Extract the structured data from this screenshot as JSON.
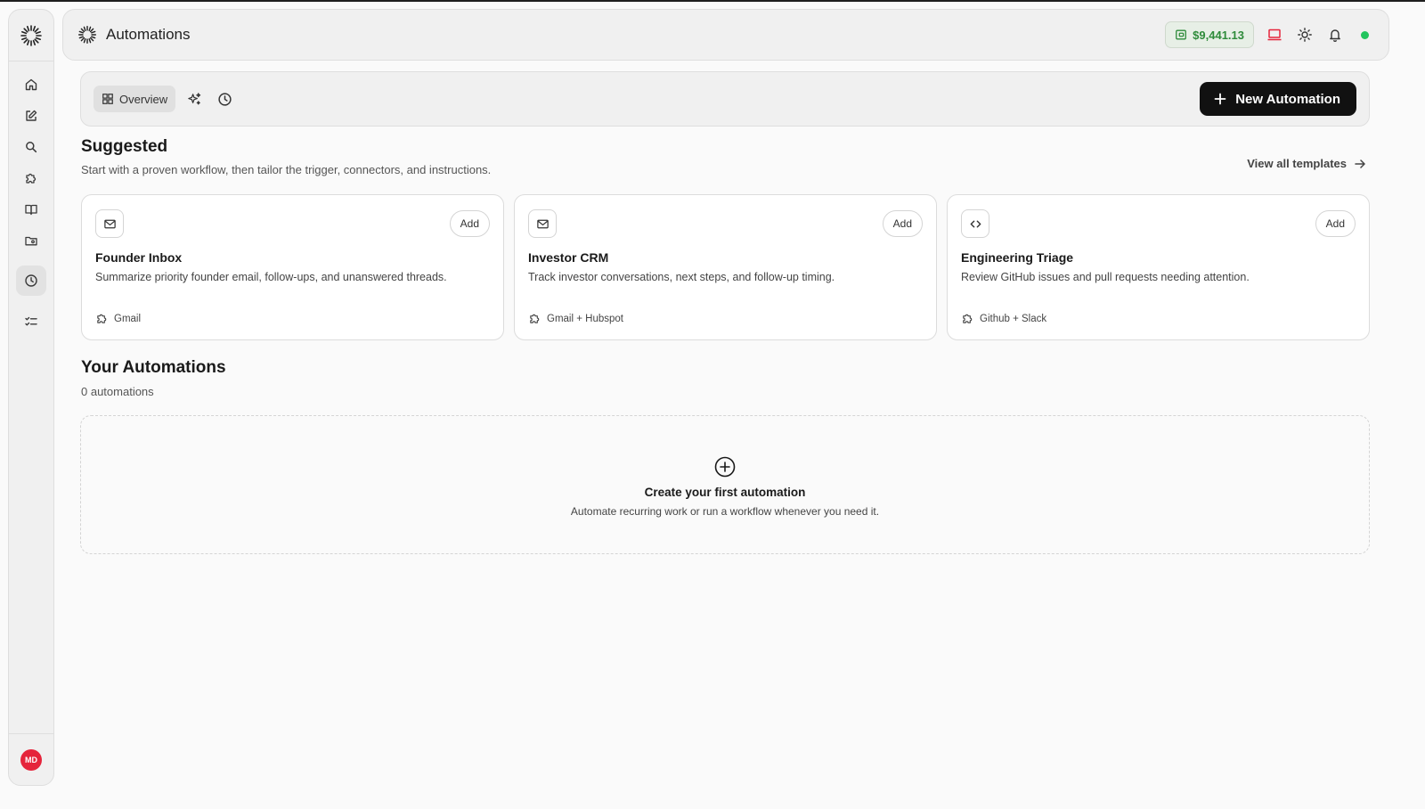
{
  "header": {
    "title": "Automations",
    "balance": "$9,441.13",
    "icons": [
      "wallet-icon",
      "laptop-icon",
      "sun-icon",
      "bell-icon",
      "status-online"
    ]
  },
  "sidebar": {
    "items": [
      {
        "name": "home",
        "icon": "home-icon"
      },
      {
        "name": "compose",
        "icon": "edit-icon"
      },
      {
        "name": "search",
        "icon": "search-icon"
      },
      {
        "name": "integrations",
        "icon": "puzzle-icon"
      },
      {
        "name": "library",
        "icon": "book-icon"
      },
      {
        "name": "files",
        "icon": "folder-icon"
      },
      {
        "name": "automations",
        "icon": "clock-icon",
        "active": true
      },
      {
        "name": "tasks",
        "icon": "checklist-icon"
      }
    ],
    "avatar_initials": "MD"
  },
  "toolbar": {
    "tab_overview": "Overview",
    "new_button": "New Automation"
  },
  "suggested": {
    "title": "Suggested",
    "subtitle": "Start with a proven workflow, then tailor the trigger, connectors, and instructions.",
    "view_all": "View all templates",
    "cards": [
      {
        "icon": "mail-icon",
        "add_label": "Add",
        "title": "Founder Inbox",
        "description": "Summarize priority founder email, follow-ups, and unanswered threads.",
        "connectors": "Gmail"
      },
      {
        "icon": "mail-icon",
        "add_label": "Add",
        "title": "Investor CRM",
        "description": "Track investor conversations, next steps, and follow-up timing.",
        "connectors": "Gmail + Hubspot"
      },
      {
        "icon": "code-icon",
        "add_label": "Add",
        "title": "Engineering Triage",
        "description": "Review GitHub issues and pull requests needing attention.",
        "connectors": "Github + Slack"
      }
    ]
  },
  "automations": {
    "title": "Your Automations",
    "count": "0 automations",
    "empty_title": "Create your first automation",
    "empty_subtitle": "Automate recurring work or run a workflow whenever you need it."
  },
  "colors": {
    "accent": "#111111",
    "balance_green": "#2e8b3a",
    "status_green": "#22c55e",
    "avatar_red": "#e5243b"
  }
}
